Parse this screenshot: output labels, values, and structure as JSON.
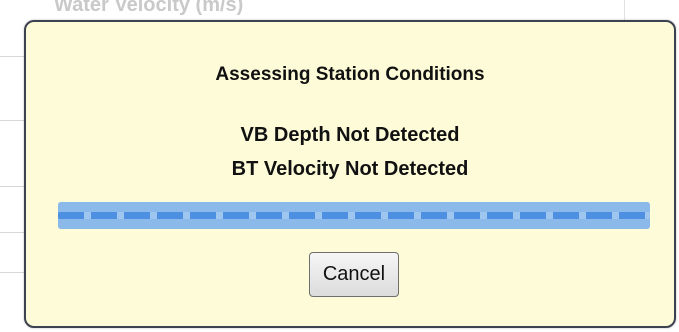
{
  "background": {
    "title": "Water Velocity (m/s)"
  },
  "dialog": {
    "title": "Assessing Station Conditions",
    "status_lines": [
      "VB Depth Not Detected",
      "BT Velocity Not Detected"
    ],
    "progress": {
      "indeterminate": true,
      "fill_fraction": 1.0
    },
    "cancel_label": "Cancel"
  },
  "colors": {
    "dialog_background": "#fdfbd8",
    "dialog_border": "#3d4250",
    "progress_track": "#9fc6ee",
    "progress_dash": "#4d8fe0"
  }
}
